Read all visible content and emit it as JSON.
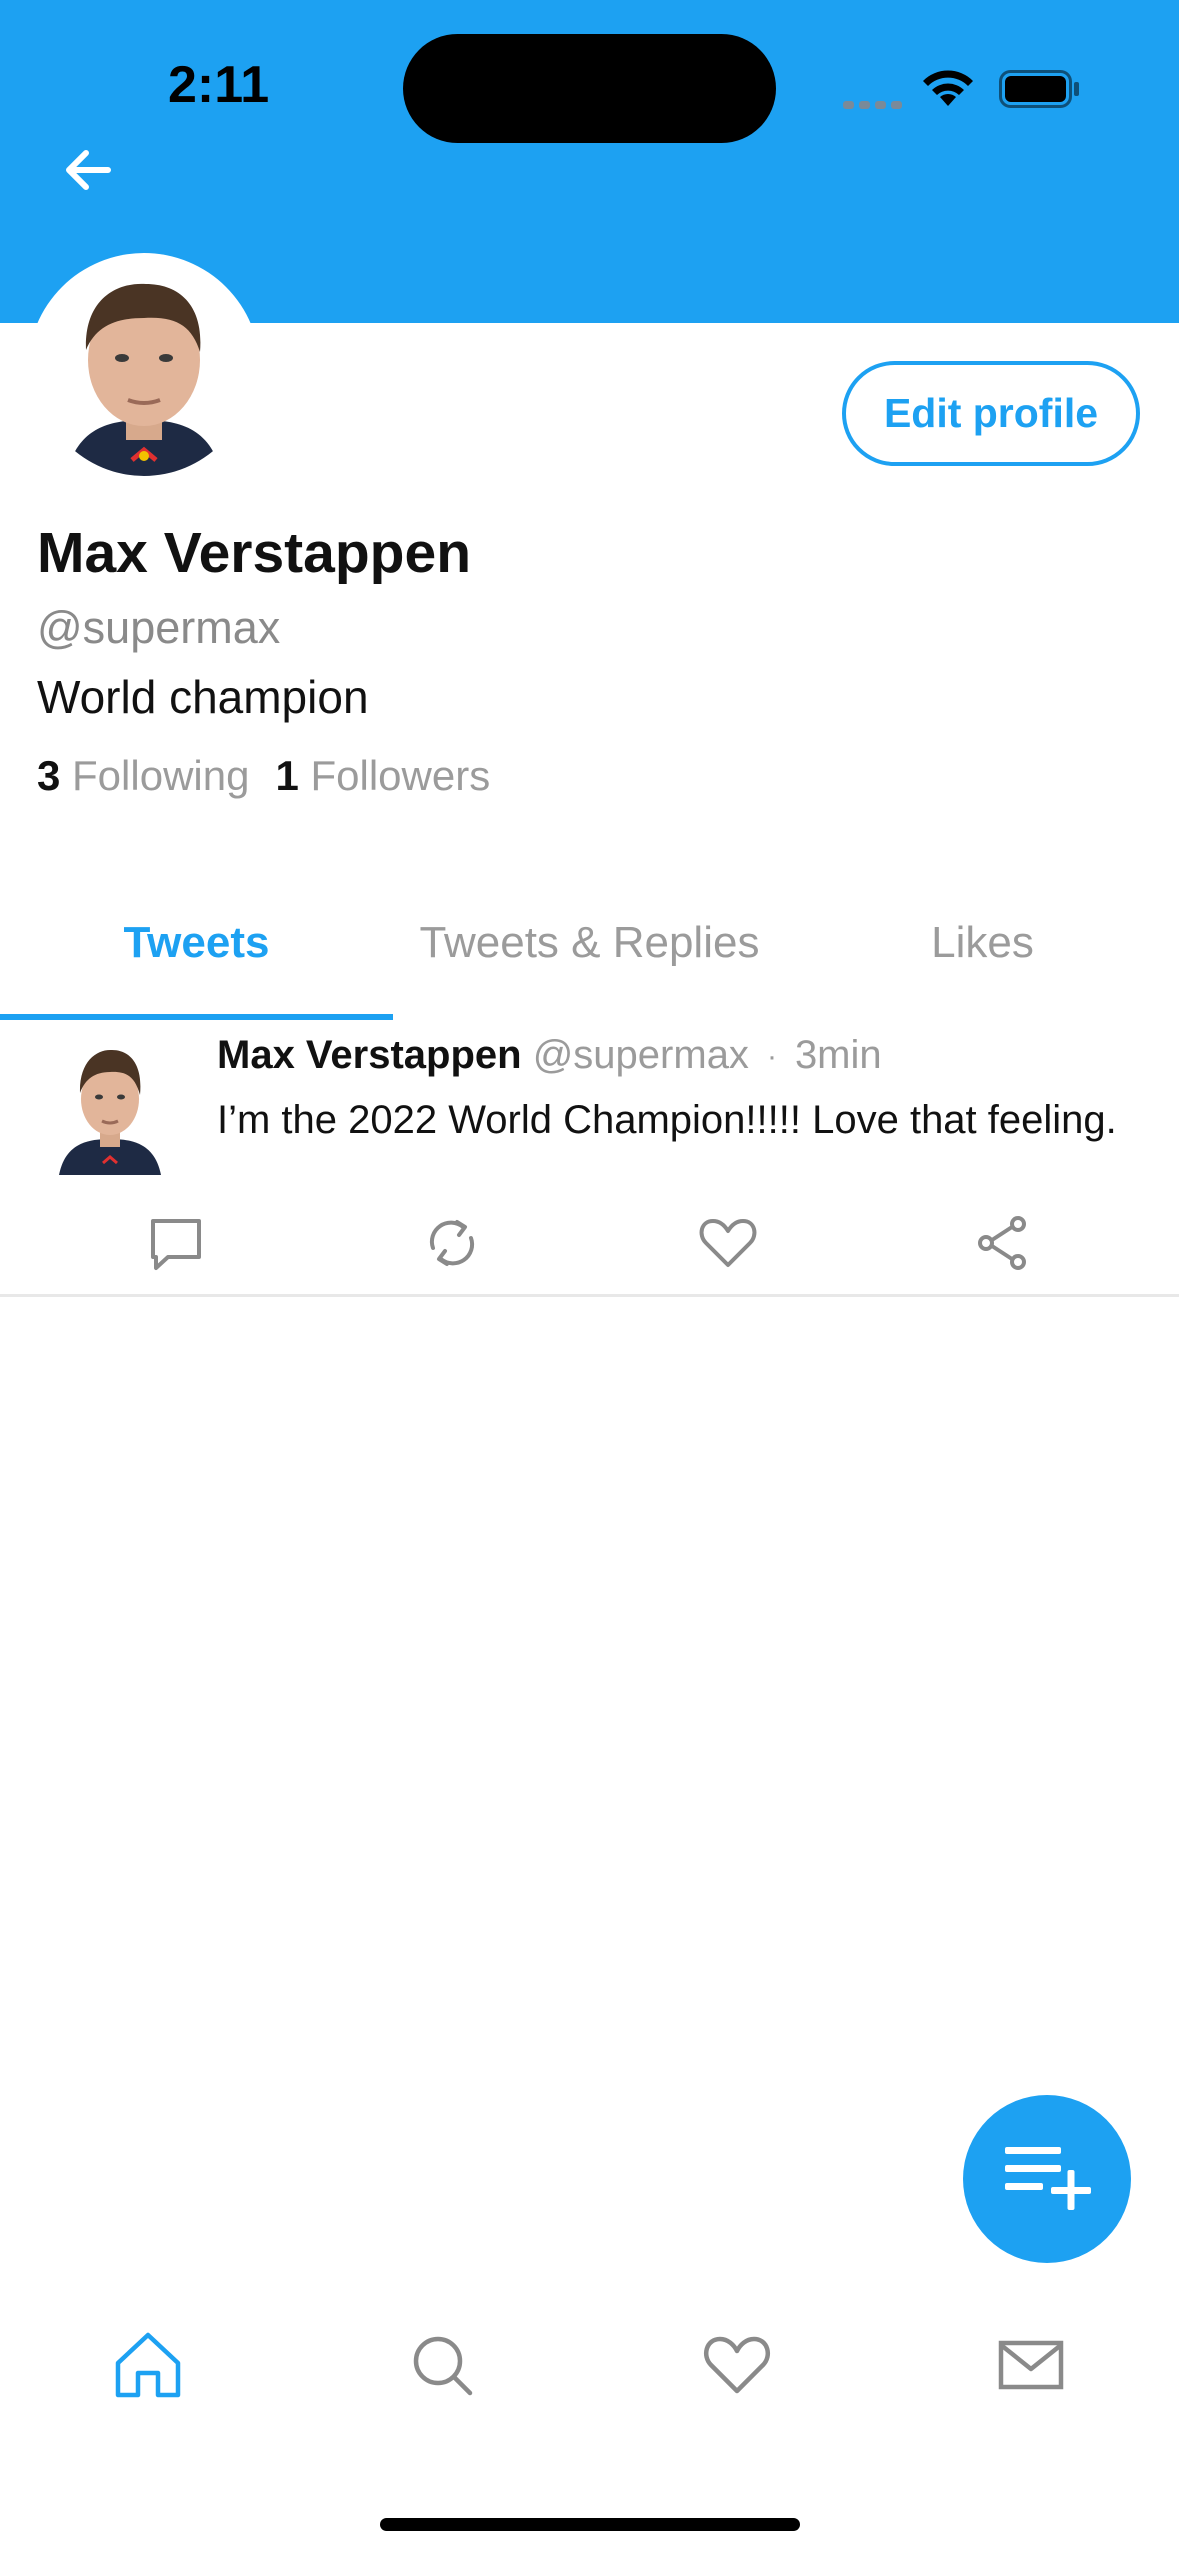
{
  "status_bar": {
    "time": "2:11"
  },
  "profile": {
    "name": "Max Verstappen",
    "handle": "@supermax",
    "bio": "World champion",
    "following_count": "3",
    "following_label": "Following",
    "followers_count": "1",
    "followers_label": "Followers",
    "edit_button_label": "Edit profile"
  },
  "tabs": [
    {
      "label": "Tweets",
      "active": true
    },
    {
      "label": "Tweets & Replies",
      "active": false
    },
    {
      "label": "Likes",
      "active": false
    }
  ],
  "tweets": [
    {
      "author": "Max Verstappen",
      "handle": "@supermax",
      "separator": "·",
      "time": "3min",
      "text": "I’m the 2022 World Champion!!!!! Love that feeling."
    }
  ],
  "tweet_actions": [
    "comment-icon",
    "retweet-icon",
    "heart-icon",
    "share-icon"
  ],
  "bottom_nav": [
    {
      "icon": "home-icon",
      "active": true
    },
    {
      "icon": "search-icon",
      "active": false
    },
    {
      "icon": "heart-icon",
      "active": false
    },
    {
      "icon": "mail-icon",
      "active": false
    }
  ],
  "colors": {
    "accent": "#1da1f2",
    "muted_text": "#9b9b9b",
    "icon_gray": "#8a8a8a"
  }
}
